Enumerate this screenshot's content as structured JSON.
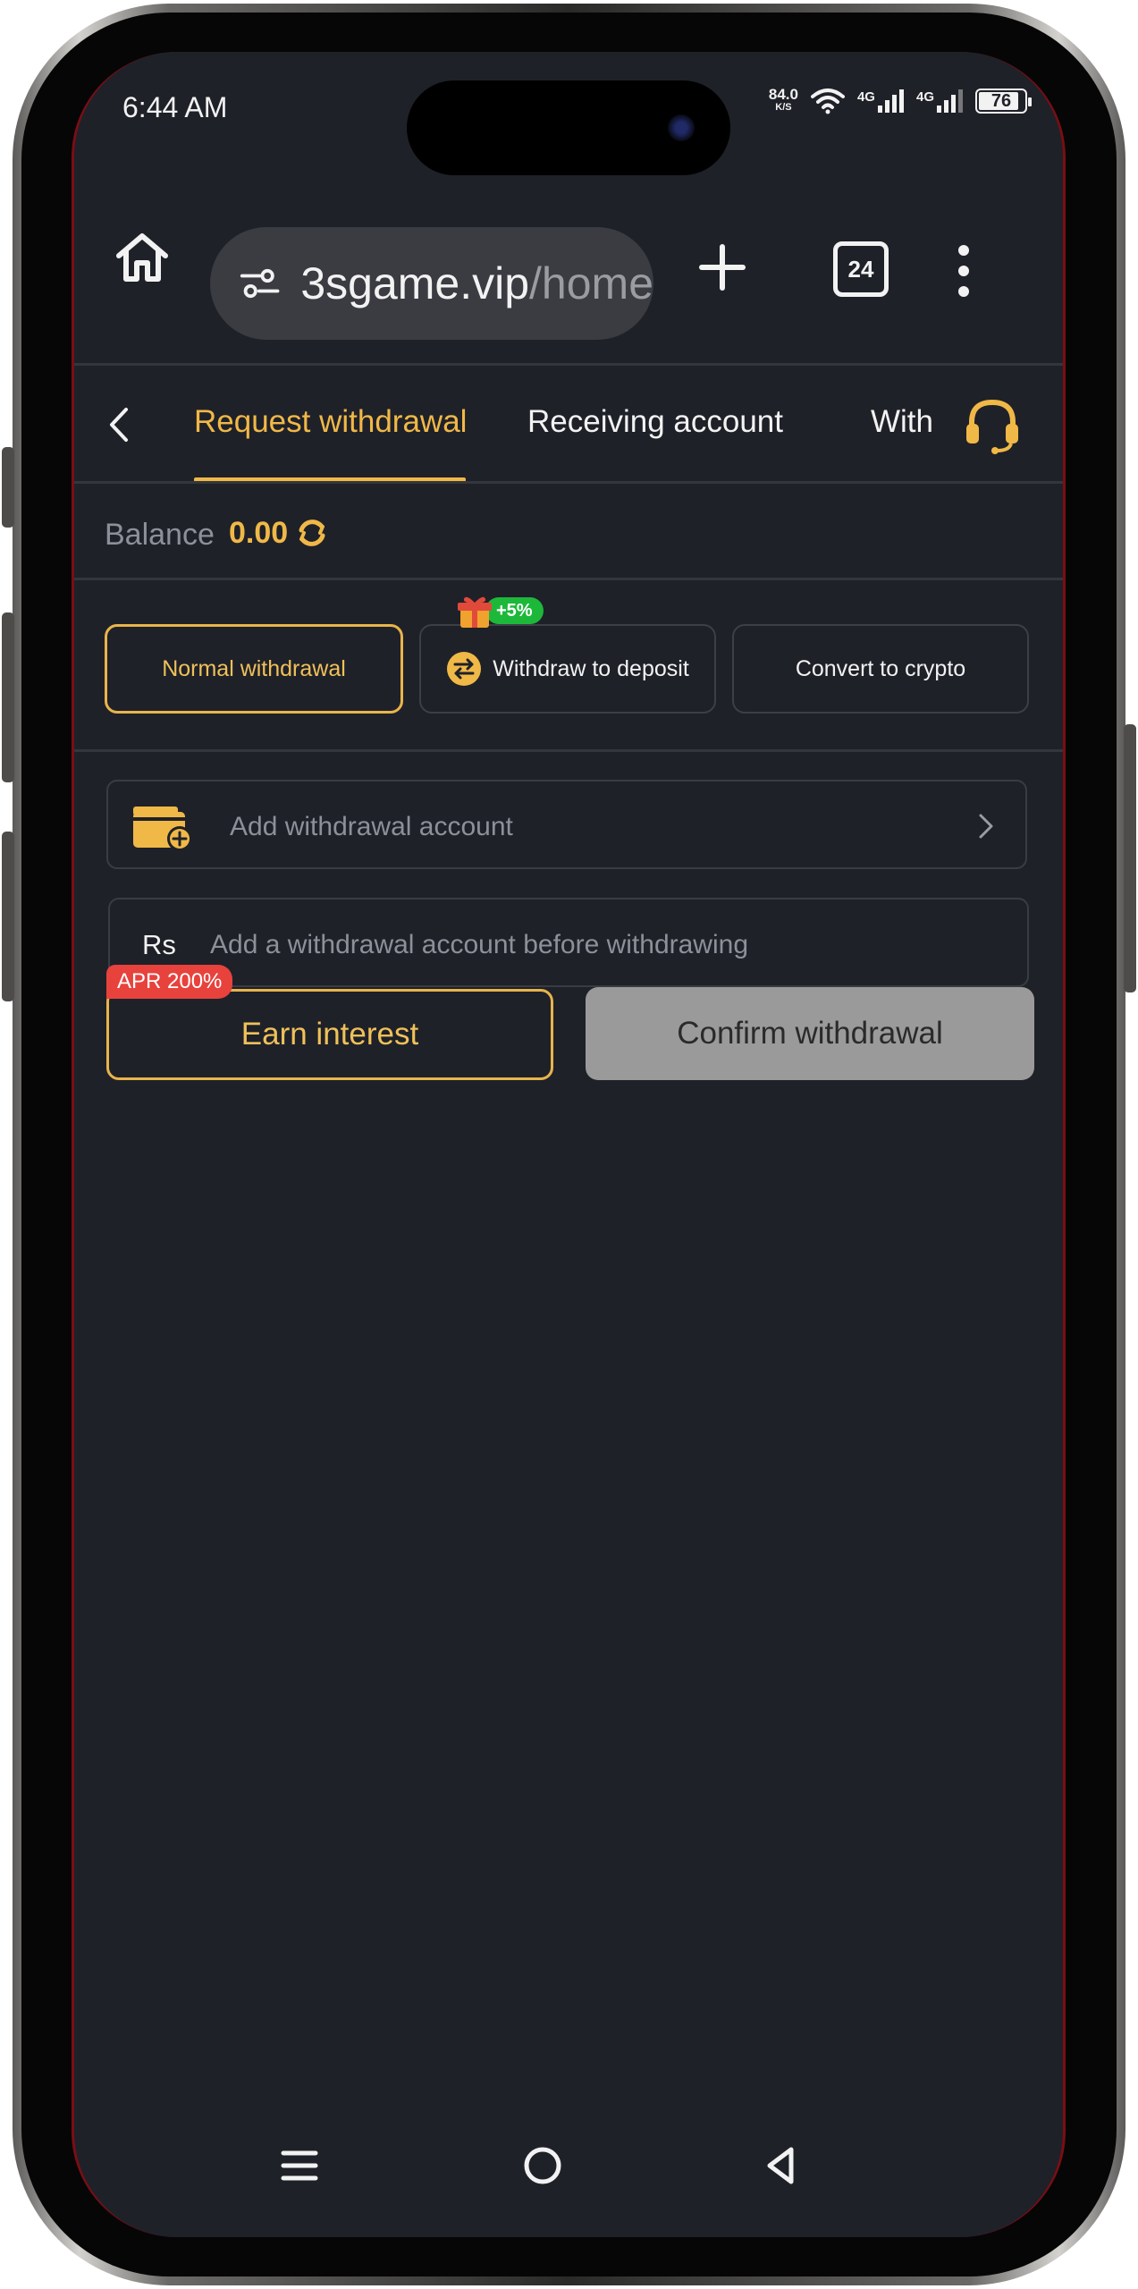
{
  "status_bar": {
    "time": "6:44 AM",
    "net_speed": "84.0",
    "net_speed_unit": "K/S",
    "signal_1_label": "4G",
    "signal_2_label": "4G",
    "battery": "76"
  },
  "browser": {
    "url_domain": "3sgame.vip",
    "url_path": "/home",
    "tab_count": "24"
  },
  "tabs": {
    "items": [
      {
        "label": "Request withdrawal",
        "active": true
      },
      {
        "label": "Receiving account",
        "active": false
      },
      {
        "label": "With",
        "active": false
      }
    ]
  },
  "balance": {
    "label": "Balance",
    "value": "0.00"
  },
  "methods": {
    "normal": "Normal withdrawal",
    "to_deposit": "Withdraw to deposit",
    "to_deposit_badge": "+5%",
    "crypto": "Convert to crypto"
  },
  "form": {
    "add_account_label": "Add withdrawal account",
    "currency_symbol": "Rs",
    "amount_placeholder": "Add a withdrawal account before withdrawing"
  },
  "actions": {
    "apr_badge": "APR 200%",
    "earn_interest": "Earn interest",
    "confirm_withdrawal": "Confirm withdrawal"
  },
  "colors": {
    "accent": "#f0b847",
    "background": "#1f2129",
    "badge_red": "#e8423d",
    "badge_green": "#1db83a",
    "disabled": "#9a9a9a"
  },
  "icons": [
    "home-icon",
    "tune-icon",
    "plus-icon",
    "tabs-icon",
    "more-vert-icon",
    "back-icon",
    "headset-icon",
    "refresh-icon",
    "gift-icon",
    "swap-icon",
    "wallet-add-icon",
    "chevron-right-icon",
    "nav-menu-icon",
    "nav-home-icon",
    "nav-back-icon"
  ]
}
